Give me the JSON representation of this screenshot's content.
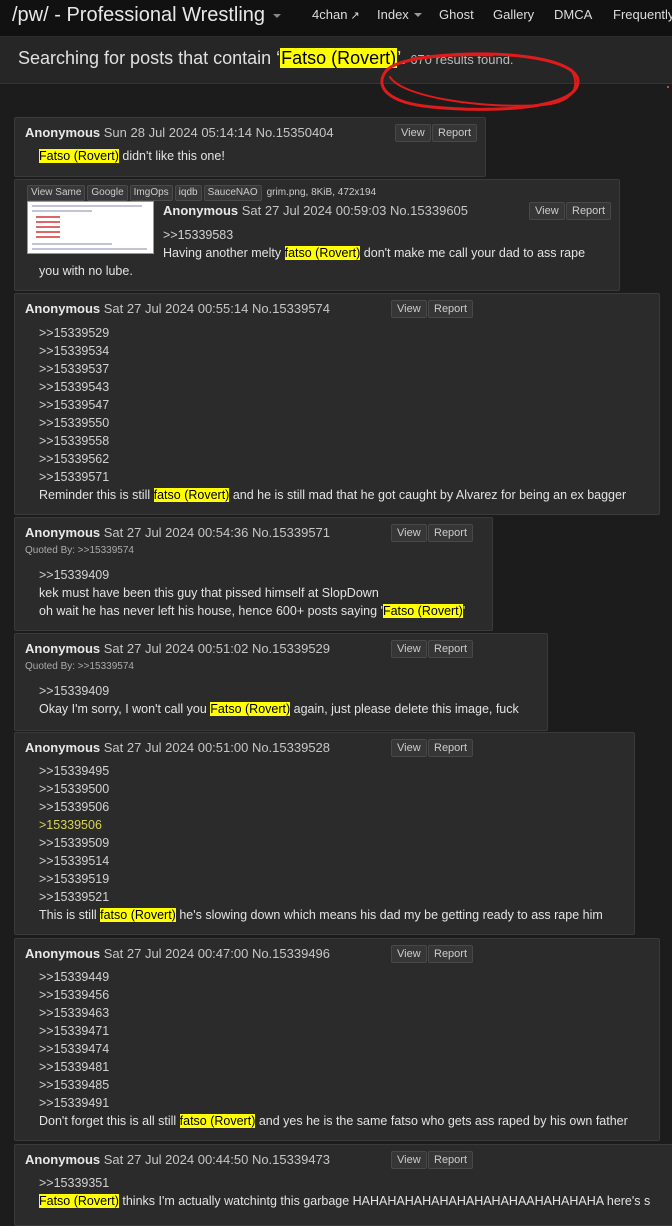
{
  "navbar": {
    "title": "/pw/ - Professional Wrestling",
    "items": [
      "4chan",
      "Index",
      "Ghost",
      "Gallery",
      "DMCA",
      "Frequently"
    ]
  },
  "search": {
    "prefix": "Searching for posts that contain ‘",
    "term": "Fatso (Rovert)",
    "suffix": "’.",
    "results": "670 results found."
  },
  "buttons": {
    "view": "View",
    "report": "Report"
  },
  "image_post": {
    "toolbar": [
      "View Same",
      "Google",
      "ImgOps",
      "iqdb",
      "SauceNAO"
    ],
    "fileinfo": "grim.png, 8KiB, 472x194"
  },
  "posts": [
    {
      "name": "Anonymous",
      "date": "Sun 28 Jul 2024 05:14:14",
      "no": "No.15350404",
      "lines": [
        [
          {
            "h": "Fatso (Rovert)"
          },
          {
            "t": " didn't like this one!"
          }
        ]
      ]
    },
    {
      "name": "Anonymous",
      "date": "Sat 27 Jul 2024 00:59:03",
      "no": "No.15339605",
      "lines": [
        [
          {
            "q": ">>15339583"
          }
        ],
        [
          {
            "t": "Having another melty "
          },
          {
            "h": "fatso (Rovert)"
          },
          {
            "t": " don't make me call your dad to ass rape"
          }
        ],
        [
          {
            "t": "you with no lube."
          }
        ]
      ]
    },
    {
      "name": "Anonymous",
      "date": "Sat 27 Jul 2024 00:55:14",
      "no": "No.15339574",
      "lines": [
        [
          {
            "q": ">>15339529"
          }
        ],
        [
          {
            "q": ">>15339534"
          }
        ],
        [
          {
            "q": ">>15339537"
          }
        ],
        [
          {
            "q": ">>15339543"
          }
        ],
        [
          {
            "q": ">>15339547"
          }
        ],
        [
          {
            "q": ">>15339550"
          }
        ],
        [
          {
            "q": ">>15339558"
          }
        ],
        [
          {
            "q": ">>15339562"
          }
        ],
        [
          {
            "q": ">>15339571"
          }
        ],
        [
          {
            "t": "Reminder this is still "
          },
          {
            "h": "fatso (Rovert)"
          },
          {
            "t": " and he is still mad that he got caught by Alvarez for being an ex bagger"
          }
        ]
      ]
    },
    {
      "name": "Anonymous",
      "date": "Sat 27 Jul 2024 00:54:36",
      "no": "No.15339571",
      "quoted_by": "Quoted By: >>15339574",
      "lines": [
        [
          {
            "q": ">>15339409"
          }
        ],
        [
          {
            "t": "kek must have been this guy that pissed himself at SlopDown"
          }
        ],
        [
          {
            "t": "oh wait he has never left his house, hence 600+ posts saying '"
          },
          {
            "h": "Fatso (Rovert)"
          },
          {
            "t": "'"
          }
        ]
      ]
    },
    {
      "name": "Anonymous",
      "date": "Sat 27 Jul 2024 00:51:02",
      "no": "No.15339529",
      "quoted_by": "Quoted By: >>15339574",
      "lines": [
        [
          {
            "q": ">>15339409"
          }
        ],
        [
          {
            "t": "Okay I'm sorry, I won't call you "
          },
          {
            "h": "Fatso (Rovert)"
          },
          {
            "t": " again, just please delete this image, fuck"
          }
        ]
      ]
    },
    {
      "name": "Anonymous",
      "date": "Sat 27 Jul 2024 00:51:00",
      "no": "No.15339528",
      "lines": [
        [
          {
            "q": ">>15339495"
          }
        ],
        [
          {
            "q": ">>15339500"
          }
        ],
        [
          {
            "q": ">>15339506"
          }
        ],
        [
          {
            "g": ">15339506"
          }
        ],
        [
          {
            "q": ">>15339509"
          }
        ],
        [
          {
            "q": ">>15339514"
          }
        ],
        [
          {
            "q": ">>15339519"
          }
        ],
        [
          {
            "q": ">>15339521"
          }
        ],
        [
          {
            "t": "This is still "
          },
          {
            "h": "fatso (Rovert)"
          },
          {
            "t": " he's slowing down which means his dad my be getting ready to ass rape him"
          }
        ]
      ]
    },
    {
      "name": "Anonymous",
      "date": "Sat 27 Jul 2024 00:47:00",
      "no": "No.15339496",
      "lines": [
        [
          {
            "q": ">>15339449"
          }
        ],
        [
          {
            "q": ">>15339456"
          }
        ],
        [
          {
            "q": ">>15339463"
          }
        ],
        [
          {
            "q": ">>15339471"
          }
        ],
        [
          {
            "q": ">>15339474"
          }
        ],
        [
          {
            "q": ">>15339481"
          }
        ],
        [
          {
            "q": ">>15339485"
          }
        ],
        [
          {
            "q": ">>15339491"
          }
        ],
        [
          {
            "t": "Don't forget this is all still "
          },
          {
            "h": "fatso (Rovert)"
          },
          {
            "t": " and yes he is the same fatso who gets ass raped by his own father"
          }
        ]
      ]
    },
    {
      "name": "Anonymous",
      "date": "Sat 27 Jul 2024 00:44:50",
      "no": "No.15339473",
      "lines": [
        [
          {
            "q": ">>15339351"
          }
        ],
        [
          {
            "h": "Fatso (Rovert)"
          },
          {
            "t": " thinks I'm actually watchintg this garbage HAHAHAHAHAHAHAHAHAHAAHAHAHAHA here's s"
          }
        ]
      ]
    }
  ]
}
